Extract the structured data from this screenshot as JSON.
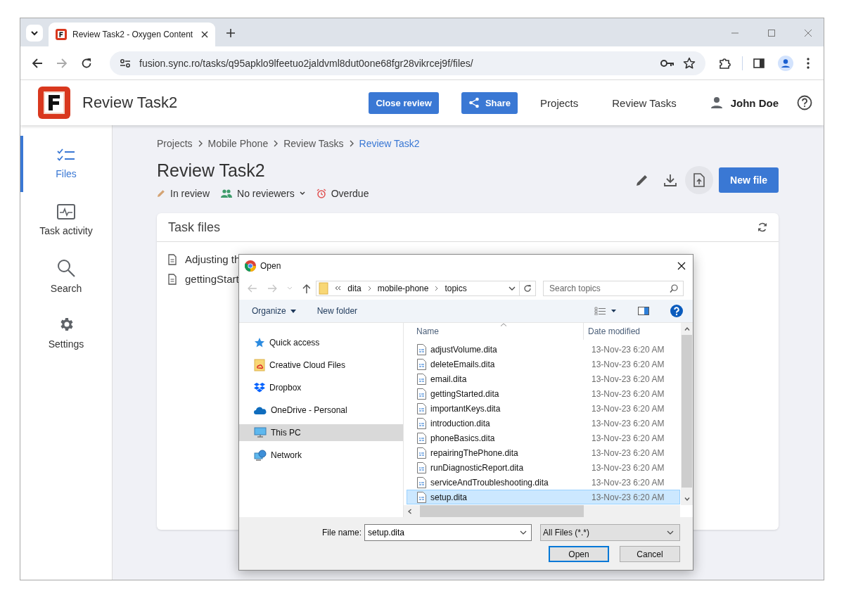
{
  "browser": {
    "tabs": [
      {
        "title": "Review Task2 - Oxygen Content",
        "selected": true
      }
    ],
    "url": "fusion.sync.ro/tasks/q95apklo9lfeetuo2jaldvml8dut0one68fgr28vikrcej9f/files/"
  },
  "header": {
    "title": "Review Task2",
    "buttons": [
      {
        "kind": "plain",
        "label": "Close review"
      },
      {
        "kind": "share",
        "label": "Share"
      }
    ],
    "links": [
      "Projects",
      "Review Tasks"
    ],
    "user": "John Doe"
  },
  "sidebar": {
    "items": [
      {
        "kind": "files",
        "label": "Files",
        "selected": true
      },
      {
        "kind": "activity",
        "label": "Task activity",
        "selected": false
      },
      {
        "kind": "search",
        "label": "Search",
        "selected": false
      },
      {
        "kind": "settings",
        "label": "Settings",
        "selected": false
      }
    ]
  },
  "breadcrumb": [
    {
      "label": "Projects",
      "selected": false
    },
    {
      "label": "Mobile Phone",
      "selected": false
    },
    {
      "label": "Review Tasks",
      "selected": false
    },
    {
      "label": "Review Task2",
      "selected": true
    }
  ],
  "page": {
    "title": "Review Task2",
    "status": [
      {
        "kind": "state",
        "text": "In review"
      },
      {
        "kind": "reviewers",
        "text": "No reviewers"
      },
      {
        "kind": "due",
        "text": "Overdue"
      }
    ],
    "new_file_button": "New file"
  },
  "task_files": {
    "title": "Task files",
    "files": [
      "Adjusting th",
      "gettingStart"
    ]
  },
  "dialog": {
    "title": "Open",
    "path": [
      "dita",
      "mobile-phone",
      "topics"
    ],
    "search": {
      "placeholder": "Search topics"
    },
    "toolbar": [
      "Organize",
      "New folder"
    ],
    "nav_pane": [
      {
        "kind": "quick",
        "label": "Quick access",
        "selected": false
      },
      {
        "kind": "cloud-folder",
        "label": "Creative Cloud Files",
        "selected": false
      },
      {
        "kind": "dropbox",
        "label": "Dropbox",
        "selected": false
      },
      {
        "kind": "onedrive",
        "label": "OneDrive - Personal",
        "selected": false
      },
      {
        "kind": "pc",
        "label": "This PC",
        "selected": true
      },
      {
        "kind": "network",
        "label": "Network",
        "selected": false
      }
    ],
    "columns": [
      "Name",
      "Date modified"
    ],
    "files": [
      {
        "name": "adjustVolume.dita",
        "date": "13-Nov-23 6:20 AM",
        "selected": false
      },
      {
        "name": "deleteEmails.dita",
        "date": "13-Nov-23 6:20 AM",
        "selected": false
      },
      {
        "name": "email.dita",
        "date": "13-Nov-23 6:20 AM",
        "selected": false
      },
      {
        "name": "gettingStarted.dita",
        "date": "13-Nov-23 6:20 AM",
        "selected": false
      },
      {
        "name": "importantKeys.dita",
        "date": "13-Nov-23 6:20 AM",
        "selected": false
      },
      {
        "name": "introduction.dita",
        "date": "13-Nov-23 6:20 AM",
        "selected": false
      },
      {
        "name": "phoneBasics.dita",
        "date": "13-Nov-23 6:20 AM",
        "selected": false
      },
      {
        "name": "repairingThePhone.dita",
        "date": "13-Nov-23 6:20 AM",
        "selected": false
      },
      {
        "name": "runDiagnosticReport.dita",
        "date": "13-Nov-23 6:20 AM",
        "selected": false
      },
      {
        "name": "serviceAndTroubleshooting.dita",
        "date": "13-Nov-23 6:20 AM",
        "selected": false
      },
      {
        "name": "setup.dita",
        "date": "13-Nov-23 6:20 AM",
        "selected": true
      }
    ],
    "file_name_label": "File name:",
    "file_name": "setup.dita",
    "file_type": "All Files (*.*)",
    "buttons": [
      {
        "kind": "default",
        "label": "Open"
      },
      {
        "kind": "normal",
        "label": "Cancel"
      }
    ]
  }
}
